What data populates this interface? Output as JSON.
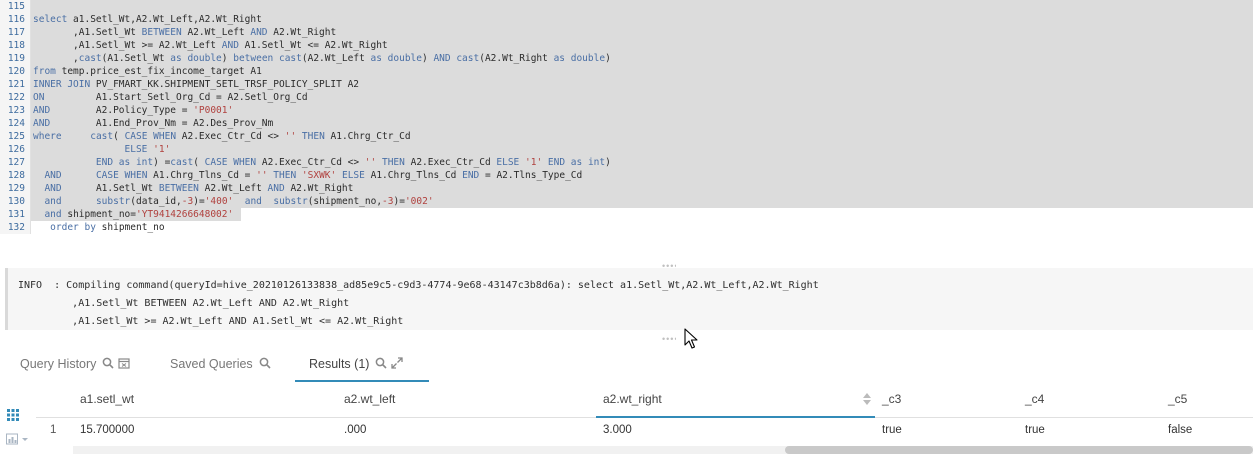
{
  "editor": {
    "lines": [
      {
        "num": "115",
        "code": "",
        "selected": true,
        "sel_width": 1222
      },
      {
        "num": "116",
        "code": "<span class=\"k\">select</span> a1.Setl_Wt,A2.Wt_Left,A2.Wt_Right",
        "selected": true,
        "sel_width": 1222
      },
      {
        "num": "117",
        "code": "       ,A1.Setl_Wt <span class=\"k\">BETWEEN</span> A2.Wt_Left <span class=\"k\">AND</span> A2.Wt_Right",
        "selected": true,
        "sel_width": 1222
      },
      {
        "num": "118",
        "code": "       ,A1.Setl_Wt >= A2.Wt_Left <span class=\"k\">AND</span> A1.Setl_Wt <= A2.Wt_Right",
        "selected": true,
        "sel_width": 1222
      },
      {
        "num": "119",
        "code": "       ,<span class=\"k\">cast</span>(A1.Setl_Wt <span class=\"k\">as double</span>) <span class=\"k\">between cast</span>(A2.Wt_Left <span class=\"k\">as double</span>) <span class=\"k\">AND cast</span>(A2.Wt_Right <span class=\"k\">as double</span>)",
        "selected": true,
        "sel_width": 1222
      },
      {
        "num": "120",
        "code": "<span class=\"k\">from</span> temp.price_est_fix_income_target A1",
        "selected": true,
        "sel_width": 1222
      },
      {
        "num": "121",
        "code": "<span class=\"k\">INNER JOIN</span> PV_FMART_KK.SHIPMENT_SETL_TRSF_POLICY_SPLIT A2",
        "selected": true,
        "sel_width": 1222
      },
      {
        "num": "122",
        "code": "<span class=\"k\">ON</span>         A1.Start_Setl_Org_Cd = A2.Setl_Org_Cd",
        "selected": true,
        "sel_width": 1222
      },
      {
        "num": "123",
        "code": "<span class=\"k\">AND</span>        A2.Policy_Type = <span class=\"s\">'P0001'</span>",
        "selected": true,
        "sel_width": 1222
      },
      {
        "num": "124",
        "code": "<span class=\"k\">AND</span>        A1.End_Prov_Nm = A2.Des_Prov_Nm",
        "selected": true,
        "sel_width": 1222
      },
      {
        "num": "125",
        "code": "<span class=\"k\">where</span>     <span class=\"k\">cast</span>( <span class=\"k\">CASE WHEN</span> A2.Exec_Ctr_Cd <> <span class=\"s\">''</span> <span class=\"k\">THEN</span> A1.Chrg_Ctr_Cd",
        "selected": true,
        "sel_width": 1222
      },
      {
        "num": "126",
        "code": "                <span class=\"k\">ELSE</span> <span class=\"s\">'1'</span>",
        "selected": true,
        "sel_width": 1222
      },
      {
        "num": "127",
        "code": "           <span class=\"k\">END as int</span>) =<span class=\"k\">cast</span>( <span class=\"k\">CASE WHEN</span> A2.Exec_Ctr_Cd <> <span class=\"s\">''</span> <span class=\"k\">THEN</span> A2.Exec_Ctr_Cd <span class=\"k\">ELSE</span> <span class=\"s\">'1'</span> <span class=\"k\">END as int</span>)",
        "selected": true,
        "sel_width": 1222
      },
      {
        "num": "128",
        "code": "  <span class=\"k\">AND</span>      <span class=\"k\">CASE WHEN</span> A1.Chrg_Tlns_Cd = <span class=\"s\">''</span> <span class=\"k\">THEN</span> <span class=\"s\">'SXWK'</span> <span class=\"k\">ELSE</span> A1.Chrg_Tlns_Cd <span class=\"k\">END</span> = A2.Tlns_Type_Cd",
        "selected": true,
        "sel_width": 1222
      },
      {
        "num": "129",
        "code": "  <span class=\"k\">AND</span>      A1.Setl_Wt <span class=\"k\">BETWEEN</span> A2.Wt_Left <span class=\"k\">AND</span> A2.Wt_Right",
        "selected": true,
        "sel_width": 1222
      },
      {
        "num": "130",
        "code": "  <span class=\"k\">and</span>      <span class=\"k\">substr</span>(data_id,<span class=\"n\">-3</span>)=<span class=\"s\">'400'</span>  <span class=\"k\">and</span>  <span class=\"k\">substr</span>(shipment_no,<span class=\"n\">-3</span>)=<span class=\"s\">'002'</span>",
        "selected": true,
        "sel_width": 1222
      },
      {
        "num": "131",
        "code": "  <span class=\"k\">and</span> shipment_no=<span class=\"s\">'YT9414266648002'</span>",
        "selected": true,
        "sel_width": 210
      },
      {
        "num": "132",
        "code": "   <span class=\"k\">order by</span> shipment_no",
        "selected": false,
        "sel_width": 0
      }
    ]
  },
  "log": {
    "lines": [
      "INFO  : Compiling command(queryId=hive_20210126133838_ad85e9c5-c9d3-4774-9e68-43147c3b8d6a): select a1.Setl_Wt,A2.Wt_Left,A2.Wt_Right",
      "         ,A1.Setl_Wt BETWEEN A2.Wt_Left AND A2.Wt_Right",
      "         ,A1.Setl_Wt >= A2.Wt_Left AND A1.Setl_Wt <= A2.Wt_Right"
    ]
  },
  "tabs": {
    "query_history": "Query History",
    "saved_queries": "Saved Queries",
    "results": "Results (1)"
  },
  "results": {
    "columns": [
      "a1.setl_wt",
      "a2.wt_left",
      "a2.wt_right",
      "_c3",
      "_c4",
      "_c5"
    ],
    "rows": [
      {
        "num": "1",
        "cells": [
          "15.700000",
          ".000",
          "3.000",
          "true",
          "true",
          "false"
        ]
      }
    ]
  },
  "colors": {
    "accent": "#338bb8",
    "keyword": "#4a6fa5",
    "string": "#b0413e",
    "selection": "#dcdcdc"
  }
}
